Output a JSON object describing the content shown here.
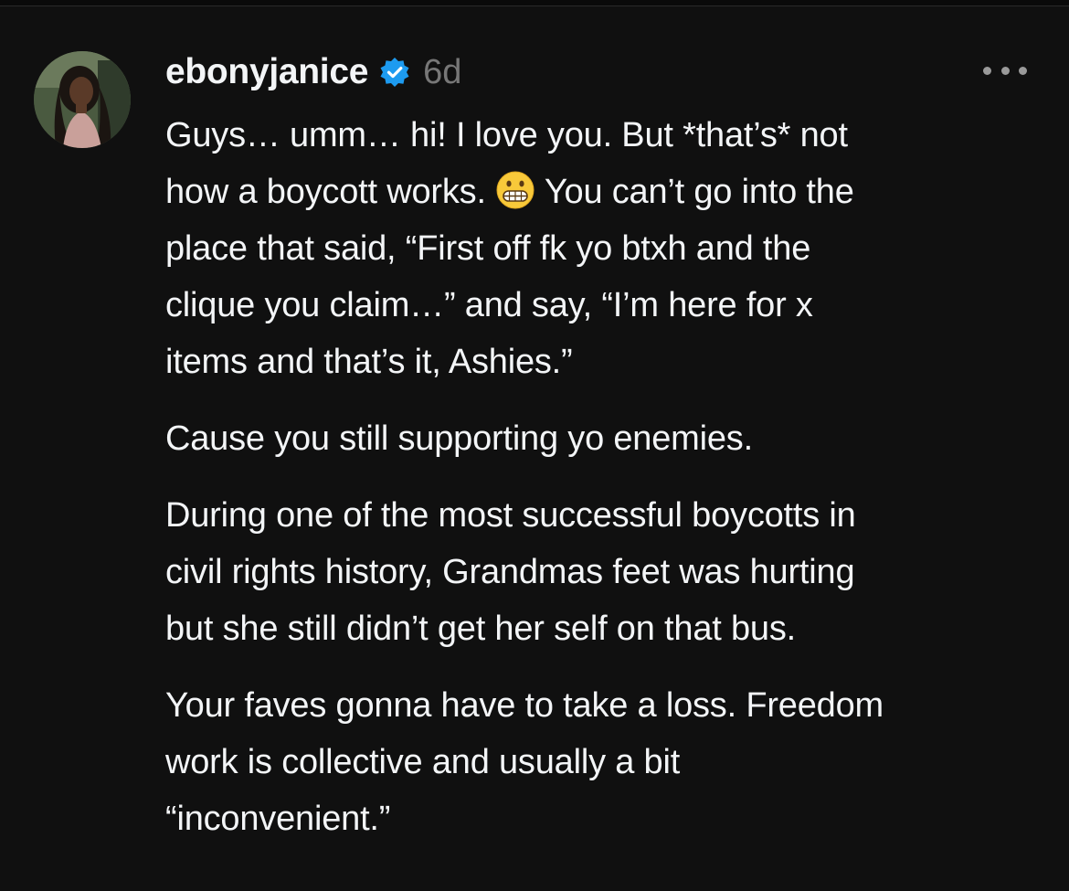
{
  "post": {
    "username": "ebonyjanice",
    "timestamp": "6d",
    "verified": true,
    "accent_color": "#1d9bf0",
    "emoji": "grimacing-face",
    "paragraphs": [
      {
        "lines": [
          {
            "before": "Guys… umm… hi! I love you. But *that’s* not",
            "after": ""
          },
          {
            "before": "how a boycott works. ",
            "after": " You can’t go into the"
          },
          {
            "before": "place that said, “First off fk yo btxh and the",
            "after": ""
          },
          {
            "before": "clique you claim…” and say, “I’m here for x",
            "after": ""
          },
          {
            "before": "items and that’s it, Ashies.”",
            "after": ""
          }
        ]
      },
      {
        "lines": [
          {
            "before": "Cause you still supporting yo enemies.",
            "after": ""
          }
        ]
      },
      {
        "lines": [
          {
            "before": "During one of the most successful boycotts in",
            "after": ""
          },
          {
            "before": "civil rights history, Grandmas feet was hurting",
            "after": ""
          },
          {
            "before": "but she still didn’t get her self on that bus.",
            "after": ""
          }
        ]
      },
      {
        "lines": [
          {
            "before": "Your faves gonna have to take a loss. Freedom",
            "after": ""
          },
          {
            "before": "work is collective and usually a bit",
            "after": ""
          },
          {
            "before": "“inconvenient.”",
            "after": ""
          }
        ]
      }
    ]
  }
}
